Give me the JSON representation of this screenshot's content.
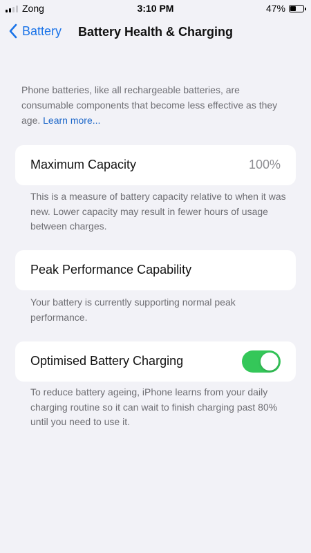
{
  "status_bar": {
    "carrier": "Zong",
    "time": "3:10 PM",
    "battery_percent": "47%",
    "battery_level": 0.47
  },
  "nav": {
    "back_label": "Battery",
    "title": "Battery Health & Charging"
  },
  "intro": {
    "text": "Phone batteries, like all rechargeable batteries, are consumable components that become less effective as they age. ",
    "link": "Learn more..."
  },
  "maximum_capacity": {
    "label": "Maximum Capacity",
    "value": "100%",
    "description": "This is a measure of battery capacity relative to when it was new. Lower capacity may result in fewer hours of usage between charges."
  },
  "peak_performance": {
    "label": "Peak Performance Capability",
    "description": "Your battery is currently supporting normal peak performance."
  },
  "optimised_charging": {
    "label": "Optimised Battery Charging",
    "enabled": true,
    "description": "To reduce battery ageing, iPhone learns from your daily charging routine so it can wait to finish charging past 80% until you need to use it."
  },
  "colors": {
    "accent": "#1a73e8",
    "toggle_on": "#34c759",
    "background": "#f2f2f7",
    "secondary_text": "#6e6e73"
  }
}
